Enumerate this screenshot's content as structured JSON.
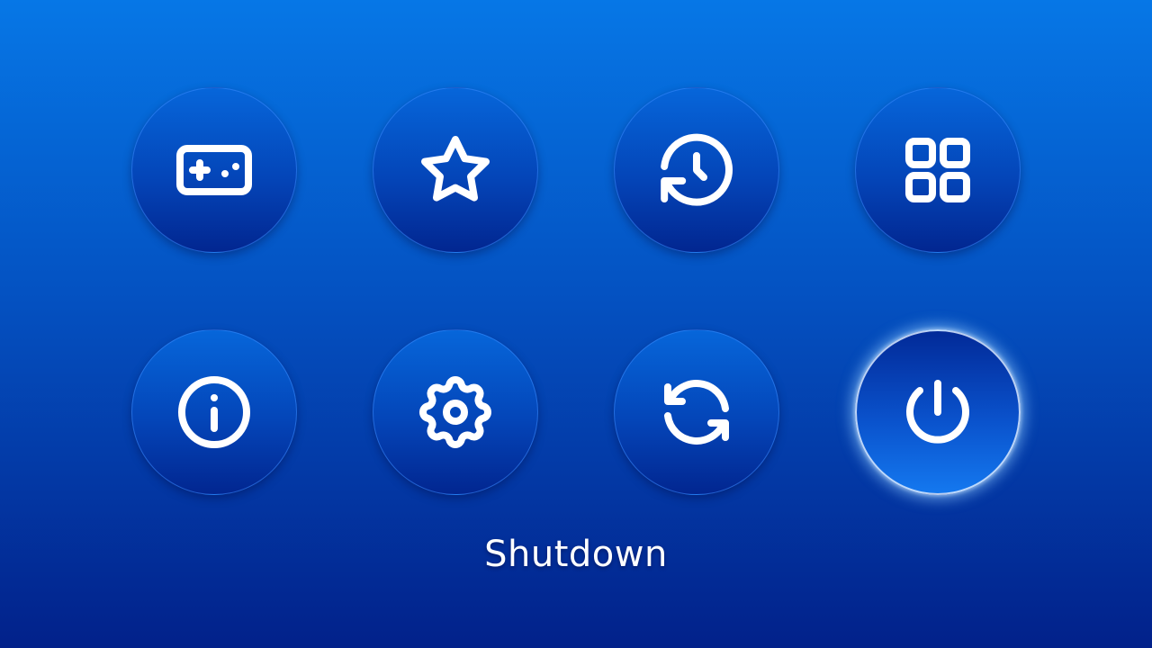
{
  "menu": {
    "items": [
      {
        "name": "games",
        "icon": "gamepad-icon"
      },
      {
        "name": "favorites",
        "icon": "star-icon"
      },
      {
        "name": "history",
        "icon": "history-icon"
      },
      {
        "name": "apps",
        "icon": "grid-icon"
      },
      {
        "name": "info",
        "icon": "info-icon"
      },
      {
        "name": "settings",
        "icon": "gear-icon"
      },
      {
        "name": "restart",
        "icon": "restart-icon"
      },
      {
        "name": "shutdown",
        "icon": "power-icon",
        "selected": true
      }
    ],
    "selected_label": "Shutdown"
  },
  "colors": {
    "background_top": "#0677e6",
    "background_bottom": "#02218a",
    "icon_stroke": "#ffffff",
    "selection_glow": "#8cc8ff"
  }
}
